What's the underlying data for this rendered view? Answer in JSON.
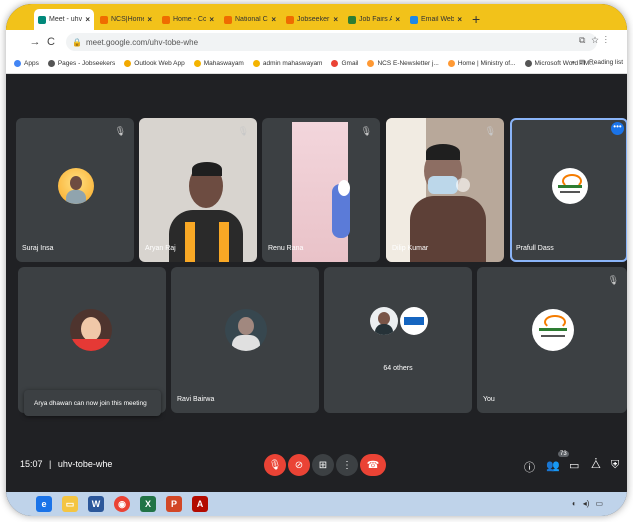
{
  "browser": {
    "tabs": [
      {
        "label": "Meet - uhv",
        "active": true,
        "color": "#00897b"
      },
      {
        "label": "NCS|Home N",
        "active": false,
        "color": "#ef6c00"
      },
      {
        "label": "Home - Conte",
        "active": false,
        "color": "#ef6c00"
      },
      {
        "label": "National Care",
        "active": false,
        "color": "#ef6c00"
      },
      {
        "label": "Jobseeker Re",
        "active": false,
        "color": "#ef6c00"
      },
      {
        "label": "Job Fairs All",
        "active": false,
        "color": "#2e7d32"
      },
      {
        "label": "Email Web C",
        "active": false,
        "color": "#1e88e5"
      }
    ],
    "new_tab": "+",
    "url": "meet.google.com/uhv-tobe-whe",
    "bookmarks": [
      "Apps",
      "Pages - Jobseekers",
      "Outlook Web App",
      "Mahaswayam",
      "admin mahaswayam",
      "Gmail",
      "NCS E-Newsletter j...",
      "Home | Ministry of...",
      "Microsoft Word - M..."
    ],
    "reading_list": "Reading list"
  },
  "meet": {
    "code": "uhv-tobe-whe",
    "time": "15:07",
    "participants_count": "73",
    "toast": "Arya dhawan can now join this meeting",
    "top_row": [
      {
        "name": "Suraj Insa",
        "kind": "avatar"
      },
      {
        "name": "Aryan Raj",
        "kind": "video"
      },
      {
        "name": "Renu Rana",
        "kind": "video"
      },
      {
        "name": "Dilip Kumar",
        "kind": "video"
      },
      {
        "name": "Prafull Dass",
        "kind": "logo"
      }
    ],
    "bottom_row": [
      {
        "name": "",
        "kind": "avatar"
      },
      {
        "name": "Ravi Bairwa",
        "kind": "avatar"
      },
      {
        "name": "64 others",
        "kind": "group"
      },
      {
        "name": "You",
        "kind": "logo"
      }
    ],
    "colors": {
      "end_call": "#ea4335",
      "accent": "#1a73e8"
    }
  }
}
